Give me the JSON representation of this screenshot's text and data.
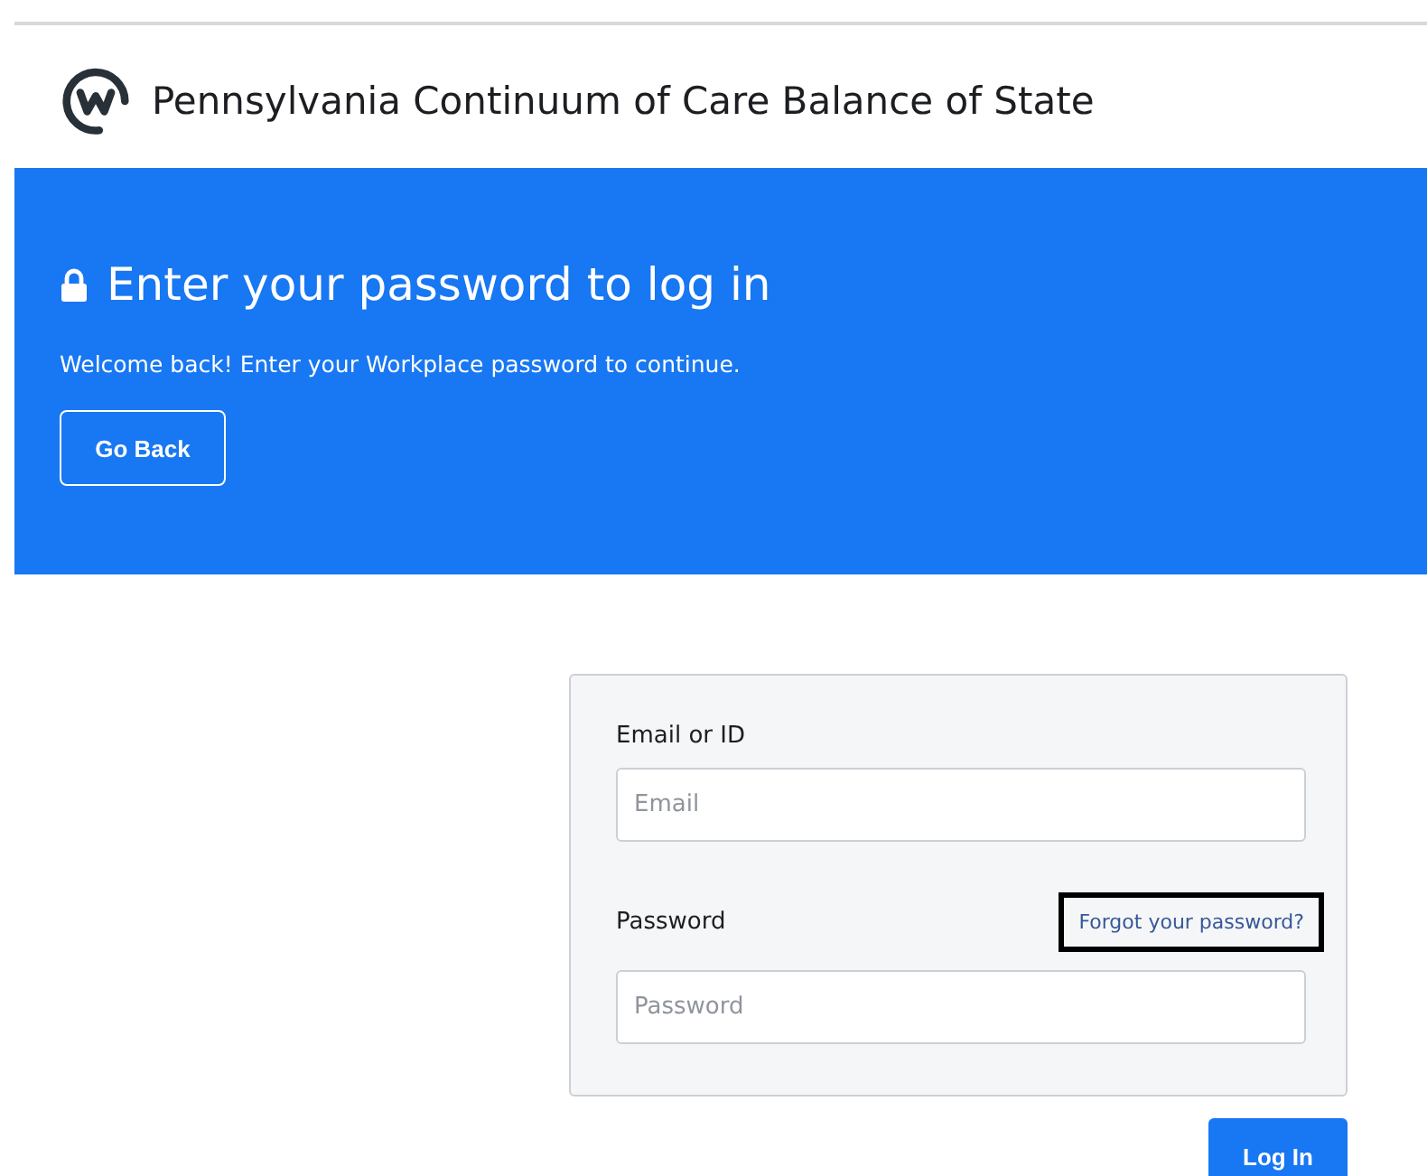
{
  "header": {
    "title": "Pennsylvania Continuum of Care Balance of State"
  },
  "banner": {
    "heading": "Enter your password to log in",
    "message": "Welcome back! Enter your Workplace password to continue.",
    "back_button": "Go Back"
  },
  "form": {
    "fields": [
      {
        "label": "Email or ID",
        "placeholder": "Email"
      },
      {
        "label": "Password",
        "placeholder": "Password",
        "link": {
          "text": "Forgot your password?",
          "highlighted": true
        }
      }
    ],
    "submit": "Log In"
  }
}
